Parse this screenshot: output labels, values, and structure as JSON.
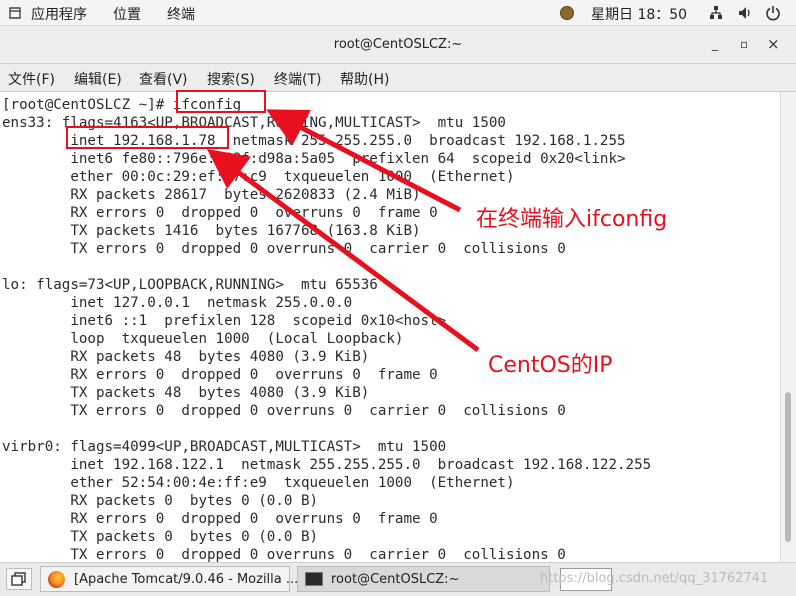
{
  "topbar": {
    "applications": "应用程序",
    "places": "位置",
    "terminal": "终端",
    "clock": "星期日 18：50",
    "icons": [
      "applications-icon",
      "avatar-icon",
      "network-icon",
      "volume-icon",
      "power-icon"
    ]
  },
  "window": {
    "title": "root@CentOSLCZ:~",
    "controls": {
      "minimize": "_",
      "maximize": "▫",
      "close": "×"
    }
  },
  "menu": [
    "文件(F)",
    "编辑(E)",
    "查看(V)",
    "搜索(S)",
    "终端(T)",
    "帮助(H)"
  ],
  "terminal": {
    "prompt": "[root@CentOSLCZ ~]# ",
    "command": "ifconfig",
    "lines": [
      "ens33: flags=4163<UP,BROADCAST,RUNNING,MULTICAST>  mtu 1500",
      "        inet 192.168.1.78  netmask 255.255.255.0  broadcast 192.168.1.255",
      "        inet6 fe80::796e:988f:d98a:5a05  prefixlen 64  scopeid 0x20<link>",
      "        ether 00:0c:29:ef:c7:c9  txqueuelen 1000  (Ethernet)",
      "        RX packets 28617  bytes 2620833 (2.4 MiB)",
      "        RX errors 0  dropped 0  overruns 0  frame 0",
      "        TX packets 1416  bytes 167768 (163.8 KiB)",
      "        TX errors 0  dropped 0 overruns 0  carrier 0  collisions 0",
      "",
      "lo: flags=73<UP,LOOPBACK,RUNNING>  mtu 65536",
      "        inet 127.0.0.1  netmask 255.0.0.0",
      "        inet6 ::1  prefixlen 128  scopeid 0x10<host>",
      "        loop  txqueuelen 1000  (Local Loopback)",
      "        RX packets 48  bytes 4080 (3.9 KiB)",
      "        RX errors 0  dropped 0  overruns 0  frame 0",
      "        TX packets 48  bytes 4080 (3.9 KiB)",
      "        TX errors 0  dropped 0 overruns 0  carrier 0  collisions 0",
      "",
      "virbr0: flags=4099<UP,BROADCAST,MULTICAST>  mtu 1500",
      "        inet 192.168.122.1  netmask 255.255.255.0  broadcast 192.168.122.255",
      "        ether 52:54:00:4e:ff:e9  txqueuelen 1000  (Ethernet)",
      "        RX packets 0  bytes 0 (0.0 B)",
      "        RX errors 0  dropped 0  overruns 0  frame 0",
      "        TX packets 0  bytes 0 (0.0 B)",
      "        TX errors 0  dropped 0 overruns 0  carrier 0  collisions 0"
    ]
  },
  "annotations": {
    "ifconfig_label": "在终端输入ifconfig",
    "ip_label": "CentOS的IP",
    "color": "#e8101e"
  },
  "taskbar": {
    "tasks": [
      "[Apache Tomcat/9.0.46 - Mozilla ...",
      "root@CentOSLCZ:~"
    ],
    "watermark": "https://blog.csdn.net/qq_31762741"
  }
}
